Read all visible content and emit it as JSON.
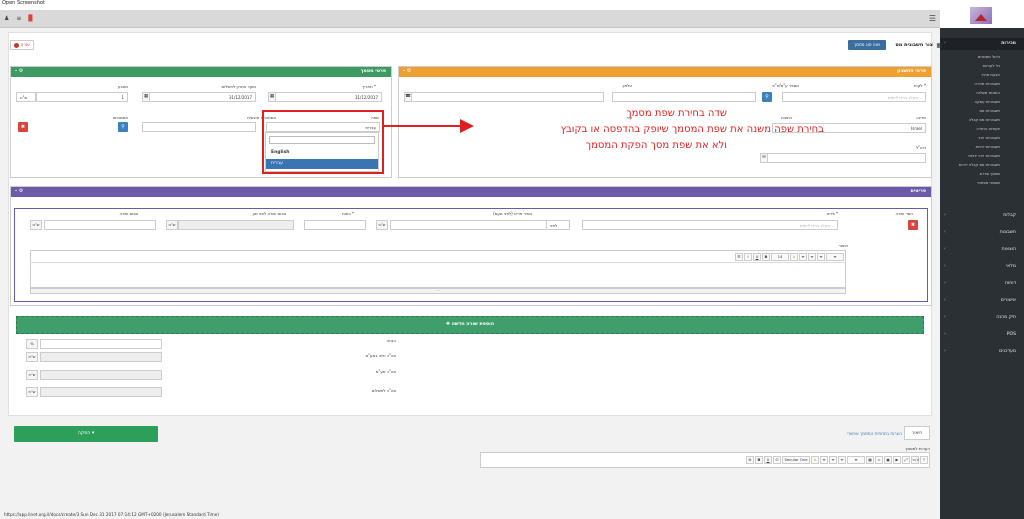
{
  "window": {
    "title": "Open Screenshot"
  },
  "sidebar": {
    "main_title": "מכירות",
    "subitems": [
      "ניהול מסמכים",
      "כל לקוחות",
      "הצעת מחיר",
      "חשבוניות מכירה",
      "הזמנות משלוח",
      "חשבוניות עסקה",
      "חשבוניות מס",
      "חשבוניות מס קבלה",
      "תעודות החזרה",
      "חשבוניות זיכוי",
      "חשבוניות ידניות",
      "חשבוניות זיכוי ידניות",
      "חשבוניות מס קבלה ידניות",
      "מסמך שדרוג",
      "מסמכי מפתחי"
    ],
    "sections": [
      "קבלות",
      "חשבונות",
      "הוצאות",
      "מלאי",
      "דוחות",
      "אישורים",
      "תיק מהנה",
      "POS",
      "מעדכנים"
    ]
  },
  "header": {
    "help_label": "עזרה",
    "doc_title": "צור חשבונית מס",
    "change_type_label": "שנה סוג מסמך"
  },
  "customer_panel": {
    "title": "פרטי החשבון",
    "customer_label": "לקוח *",
    "customer_placeholder": "הקלד ברכי לחפש...",
    "vat_label": "מספר ע\"מ/ח\"פ",
    "phone_label": "טלפון",
    "country_label": "מדינה",
    "country_value": "Israel",
    "address_label": "כתובת",
    "city_label": "עיר",
    "email_label": "דוא\"ל"
  },
  "doc_panel": {
    "title": "פרטי מסמך",
    "date_label": "תאריך *",
    "date_value": "31/12/2017",
    "due_label": "מועד אחרון לתשלום",
    "due_value": "31/12/2017",
    "currency_label": "מטבע",
    "currency_rate": "1",
    "currency_value": "ש\"ח",
    "language_label": "שפה",
    "language_value": "עברית",
    "language_options": [
      "English",
      "עברית"
    ],
    "order_label": "אסמכתא חיצונית",
    "ref_label": "אסמכתא"
  },
  "annotation": {
    "line1": "שדה בחירת שפת מסמך",
    "line2": "בחירת שפה משנה את שפת המסמך שיופק בהדפסה או בקובץ",
    "line3": "ולא את שפת מסך הפקת המסמך"
  },
  "items_panel": {
    "title": "פריטים",
    "remove_label": "הסר שורה",
    "item_label": "פריט *",
    "item_placeholder": "הקלד ברכי לחפש...",
    "price_label": "מחיר פריט (לפני מעמ)",
    "price_type": "לפני",
    "qty_label": "כמות *",
    "unit_price_label": "סכום שורה לפני מע",
    "total_label": "סכום שורה",
    "currency": "ש\"ח",
    "desc_label": "תיאור",
    "font_size": "14",
    "add_row_label": "הוספת שורה חדשה"
  },
  "totals": {
    "discount_label": "הנחה",
    "discount_unit": "%",
    "before_vat_label": "סה\"כ חייב במע\"מ",
    "vat_label": "סה\"כ מע\"מ",
    "total_label": "סה\"כ לתשלום",
    "currency": "ש\"ח"
  },
  "footer": {
    "produce_label": "הפקה",
    "tab1": "תיאור",
    "tab2": "הערות בתחתית המסמך אפשרי",
    "notes_label": "הערות למסמך",
    "font_name": "Secular One"
  },
  "status_bar": "https://app.linet.org.il/docs/create/3 Sun Dec 31 2017 07:14:12 GMT+0200 (Jerusalem Standard Time)",
  "colors": {
    "orange": "#f0a030",
    "green": "#3d9a63",
    "purple": "#6a5aa8",
    "sidebar": "#2b3035"
  }
}
